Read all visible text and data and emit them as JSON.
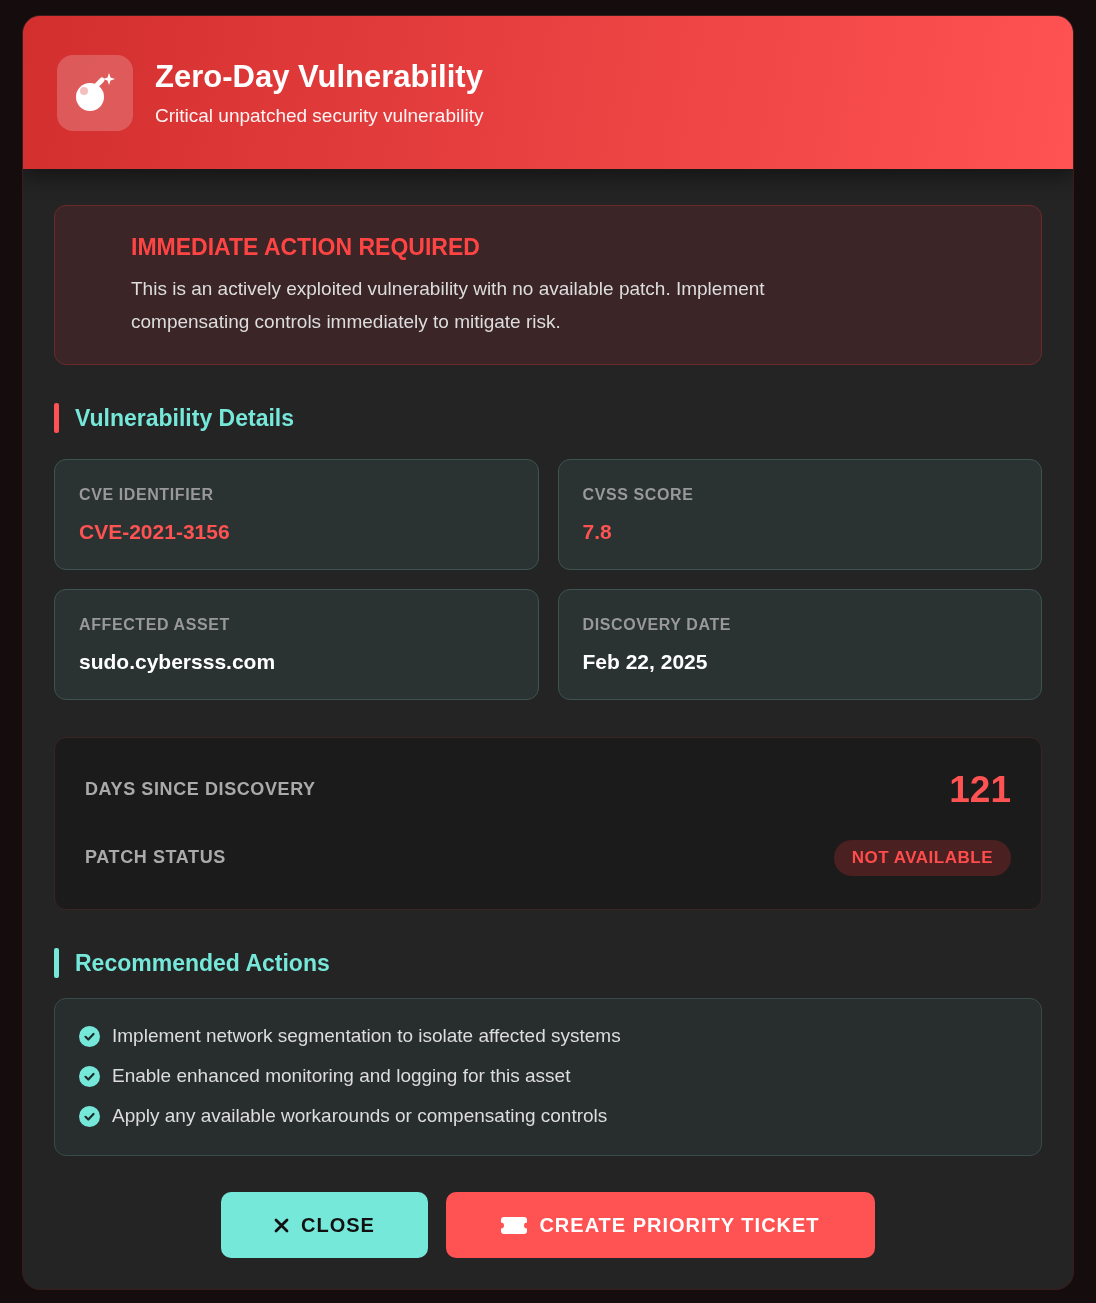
{
  "dialog": {
    "title": "Zero-Day Vulnerability",
    "subtitle": "Critical unpatched security vulnerability"
  },
  "alert": {
    "title": "IMMEDIATE ACTION REQUIRED",
    "message": "This is an actively exploited vulnerability with no available patch. Implement compensating controls immediately to mitigate risk."
  },
  "details": {
    "heading": "Vulnerability Details",
    "color": "#ff5252",
    "fields": [
      {
        "label": "CVE IDENTIFIER",
        "value": "CVE-2021-3156",
        "color": "#ff5252"
      },
      {
        "label": "CVSS SCORE",
        "value": "7.8",
        "color": "#ff5252"
      },
      {
        "label": "AFFECTED ASSET",
        "value": "sudo.cybersss.com",
        "color": "#ffffff"
      },
      {
        "label": "DISCOVERY DATE",
        "value": "Feb 22, 2025",
        "color": "#ffffff"
      }
    ]
  },
  "stats": [
    {
      "kind": "number",
      "label": "DAYS SINCE DISCOVERY",
      "value": "121"
    },
    {
      "kind": "badge",
      "label": "PATCH STATUS",
      "value": "NOT AVAILABLE"
    }
  ],
  "actions": {
    "heading": "Recommended Actions",
    "color": "#76e8da",
    "items": [
      "Implement network segmentation to isolate affected systems",
      "Enable enhanced monitoring and logging for this asset",
      "Apply any available workarounds or compensating controls"
    ]
  },
  "buttons": [
    {
      "kind": "secondary",
      "label": "CLOSE"
    },
    {
      "kind": "primary",
      "label": "CREATE PRIORITY TICKET"
    }
  ]
}
